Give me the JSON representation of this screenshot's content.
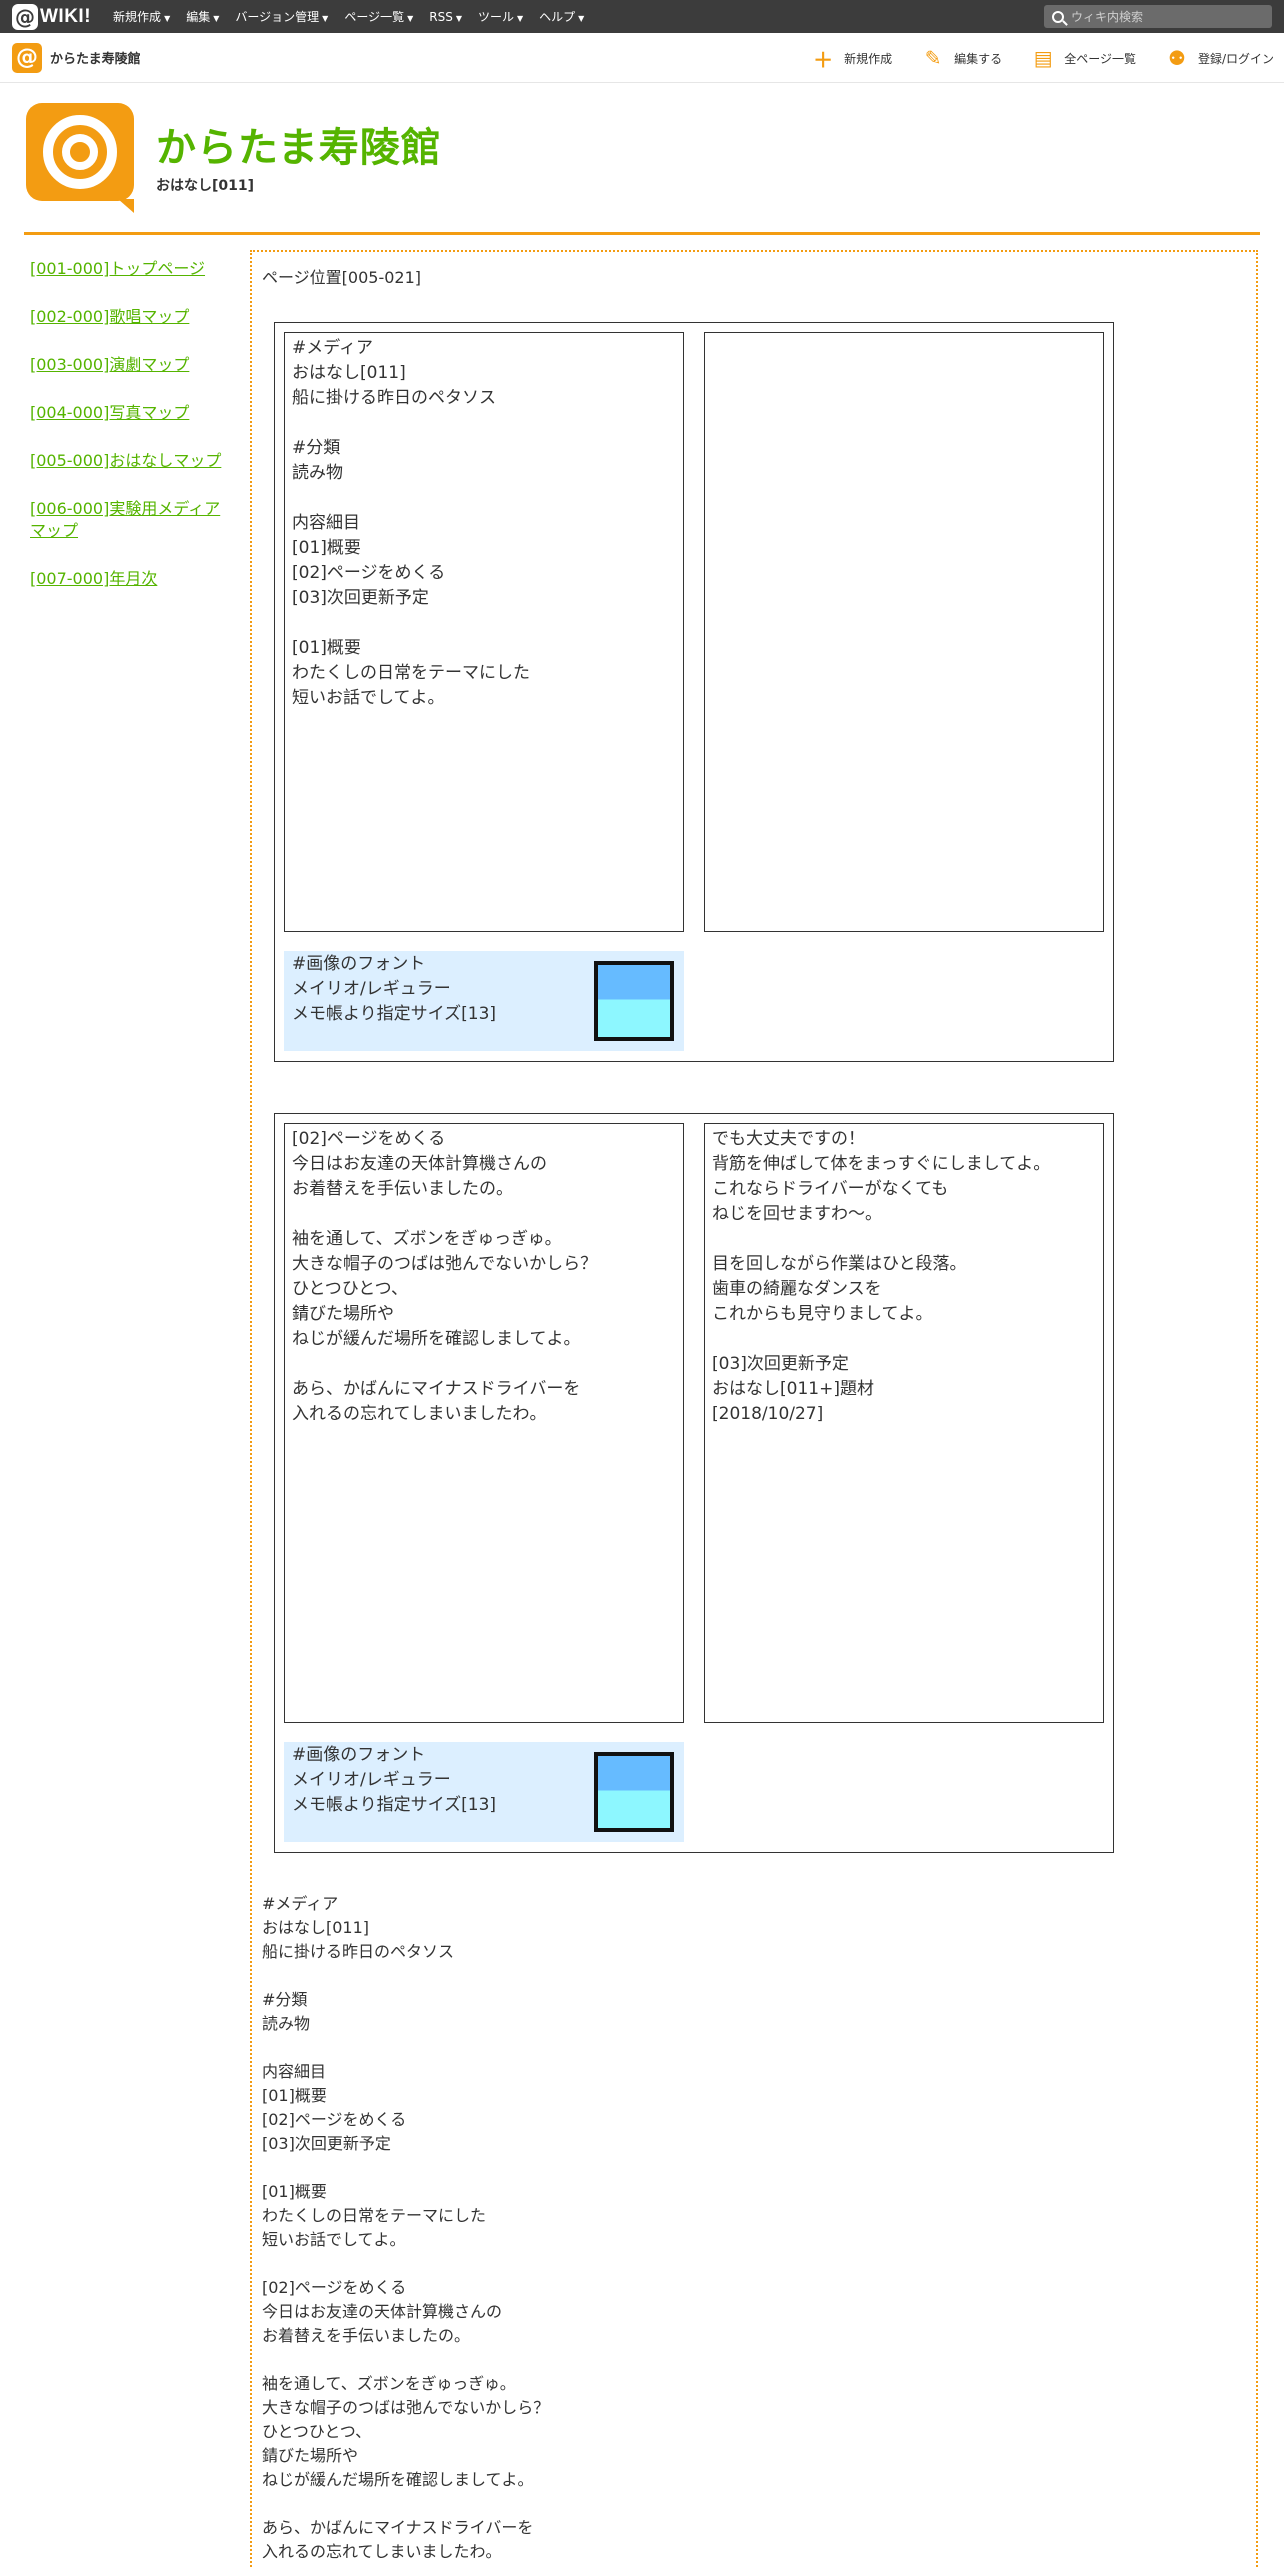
{
  "topbar": {
    "logo_text": "WIKI!",
    "menu": [
      "新規作成",
      "編集",
      "バージョン管理",
      "ページ一覧",
      "RSS",
      "ツール",
      "ヘルプ"
    ],
    "search_placeholder": "ウィキ内検索"
  },
  "subbar": {
    "site_name": "からたま寿陵館",
    "actions": [
      "新規作成",
      "編集する",
      "全ページ一覧",
      "登録/ログイン"
    ]
  },
  "header": {
    "title": "からたま寿陵館",
    "subtitle": "おはなし[011]"
  },
  "sidebar": {
    "items": [
      "[001-000]トップページ",
      "[002-000]歌唱マップ",
      "[003-000]演劇マップ",
      "[004-000]写真マップ",
      "[005-000]おはなしマップ",
      "[006-000]実験用メディアマップ",
      "[007-000]年月次"
    ]
  },
  "main": {
    "page_position": "ページ位置[005-021]",
    "box1": {
      "left_panel": "#メディア\nおはなし[011]\n船に掛ける昨日のペタソス\n\n#分類\n読み物\n\n内容細目\n[01]概要\n[02]ページをめくる\n[03]次回更新予定\n\n[01]概要\nわたくしの日常をテーマにした\n短いお話でしてよ。",
      "right_panel": "",
      "font_note": [
        "#画像のフォント",
        "メイリオ/レギュラー",
        "メモ帳より指定サイズ[13]"
      ]
    },
    "box2": {
      "left_panel": "[02]ページをめくる\n今日はお友達の天体計算機さんの\nお着替えを手伝いましたの。\n\n袖を通して、ズボンをぎゅっぎゅ。\n大きな帽子のつばは弛んでないかしら？\nひとつひとつ、\n錆びた場所や\nねじが緩んだ場所を確認しましてよ。\n\nあら、かばんにマイナスドライバーを\n入れるの忘れてしまいましたわ。",
      "right_panel": "でも大丈夫ですの！\n背筋を伸ばして体をまっすぐにしましてよ。\nこれならドライバーがなくても\nねじを回せますわ～。\n\n目を回しながら作業はひと段落。\n歯車の綺麗なダンスを\nこれからも見守りましてよ。\n\n[03]次回更新予定\nおはなし[011+]題材\n[2018/10/27]",
      "font_note": [
        "#画像のフォント",
        "メイリオ/レギュラー",
        "メモ帳より指定サイズ[13]"
      ]
    },
    "body_text": "#メディア\nおはなし[011]\n船に掛ける昨日のペタソス\n\n#分類\n読み物\n\n内容細目\n[01]概要\n[02]ページをめくる\n[03]次回更新予定\n\n[01]概要\nわたくしの日常をテーマにした\n短いお話でしてよ。\n\n[02]ページをめくる\n今日はお友達の天体計算機さんの\nお着替えを手伝いましたの。\n\n袖を通して、ズボンをぎゅっぎゅ。\n大きな帽子のつばは弛んでないかしら？\nひとつひとつ、\n錆びた場所や\nねじが緩んだ場所を確認しましてよ。\n\nあら、かばんにマイナスドライバーを\n入れるの忘れてしまいましたわ。"
  },
  "colors": {
    "accent": "#f39c12",
    "link": "#55b400",
    "topbar": "#3c3c3c",
    "note_bg": "#dcefff"
  }
}
